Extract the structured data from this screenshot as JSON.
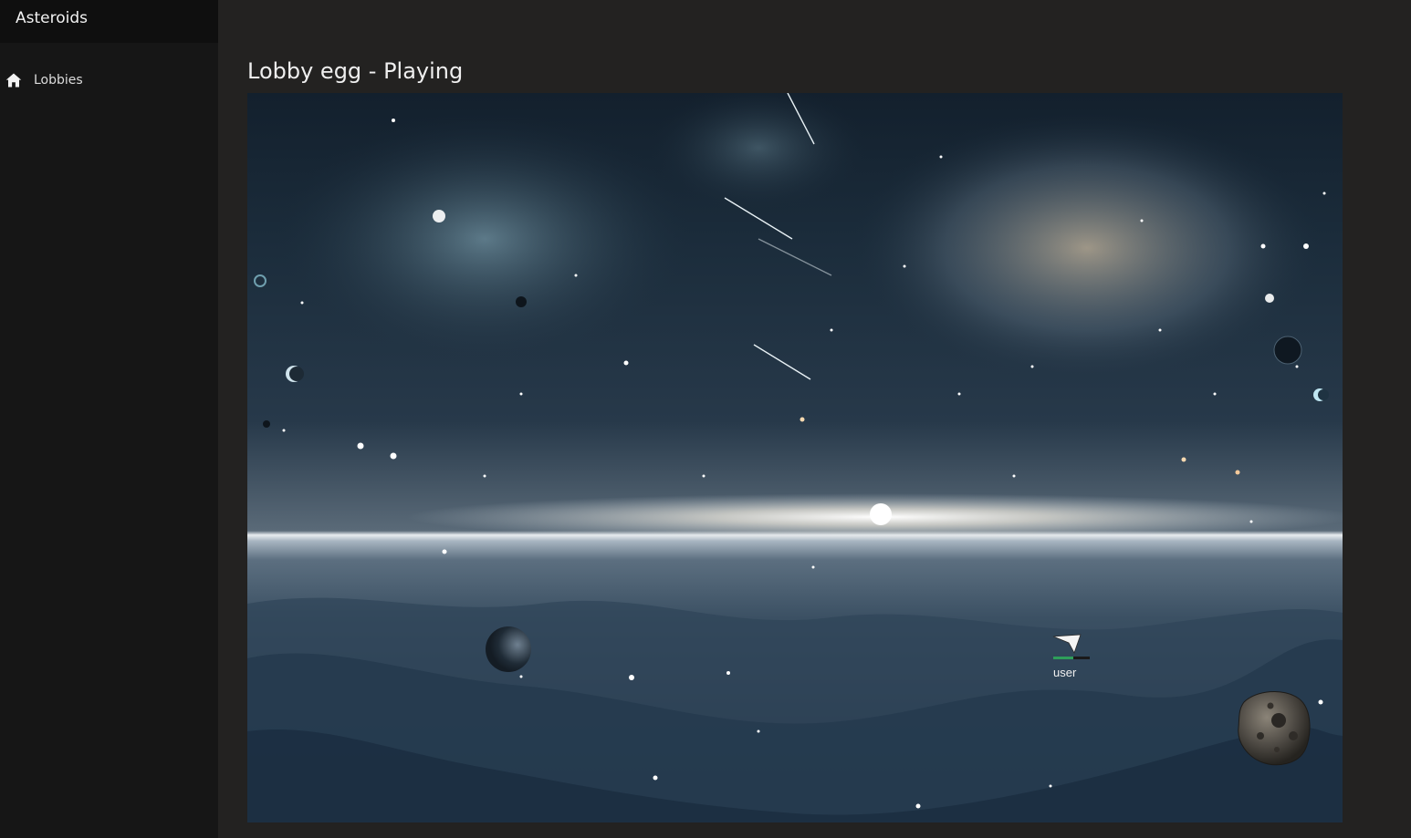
{
  "app": {
    "title": "Asteroids"
  },
  "sidebar": {
    "items": [
      {
        "label": "Lobbies",
        "icon": "home-icon"
      }
    ]
  },
  "main": {
    "title": "Lobby egg - Playing"
  },
  "game": {
    "player": {
      "name": "user",
      "health_fraction": 0.55
    },
    "colors": {
      "health_bar": "#2e9e5a",
      "health_bar_bg": "#1a1a1a"
    }
  }
}
